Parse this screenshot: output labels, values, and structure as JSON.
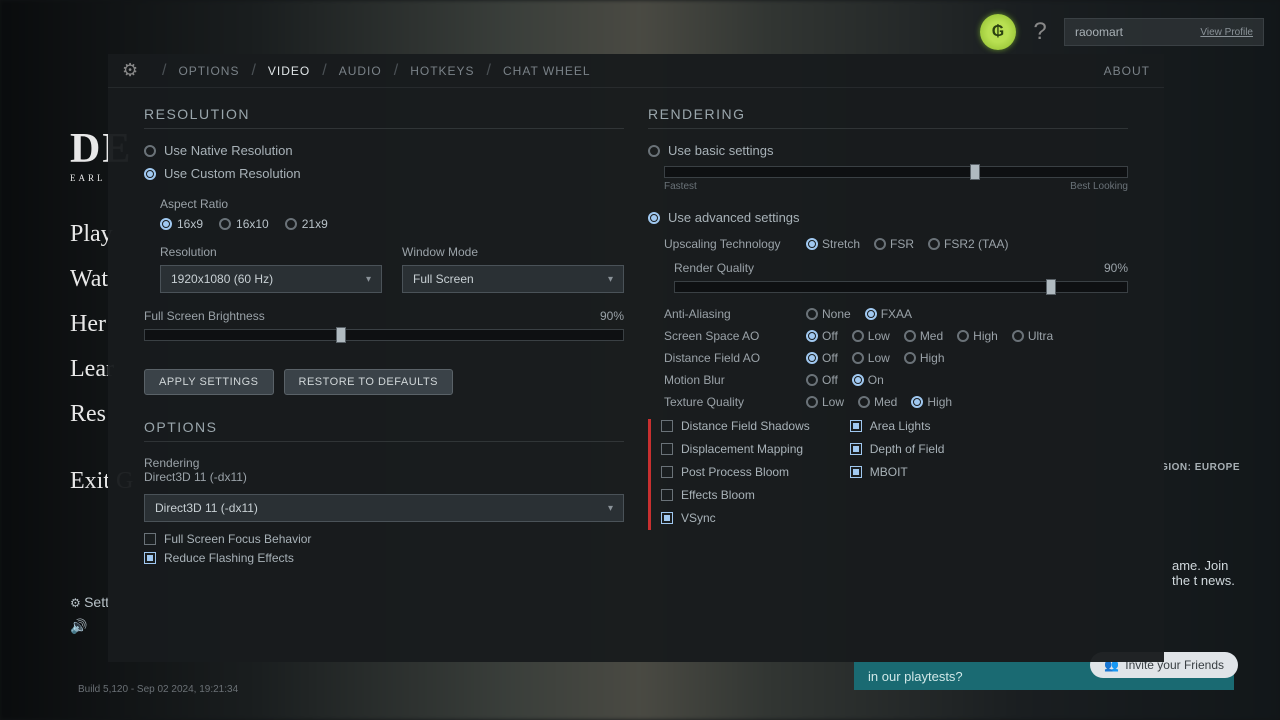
{
  "topbar": {
    "username": "raoomart",
    "view_profile": "View Profile"
  },
  "bg": {
    "logo": "DE",
    "sub": "EARL",
    "items": [
      "Play",
      "Wat",
      "Her",
      "Lear",
      "Res"
    ],
    "exit": "Exit G",
    "settings": "Sett",
    "build": "Build 5,120 - Sep 02 2024, 19:21:34",
    "region": "GION: EUROPE",
    "sidetext": "ame. Join the t news.",
    "playtest": "in our playtests?",
    "invite": "Invite your Friends"
  },
  "tabs": {
    "options": "OPTIONS",
    "video": "VIDEO",
    "audio": "AUDIO",
    "hotkeys": "HOTKEYS",
    "chatwheel": "CHAT WHEEL",
    "about": "ABOUT"
  },
  "left": {
    "resolution_title": "RESOLUTION",
    "native": "Use Native Resolution",
    "custom": "Use Custom Resolution",
    "aspect_label": "Aspect Ratio",
    "aspects": [
      "16x9",
      "16x10",
      "21x9"
    ],
    "resolution_label": "Resolution",
    "resolution_value": "1920x1080 (60 Hz)",
    "window_label": "Window Mode",
    "window_value": "Full Screen",
    "brightness_label": "Full Screen Brightness",
    "brightness_value": "90%",
    "apply": "APPLY SETTINGS",
    "restore": "RESTORE TO DEFAULTS",
    "options_title": "OPTIONS",
    "rendering_label": "Rendering",
    "rendering_value": "Direct3D 11 (-dx11)",
    "rendering_select": "Direct3D 11 (-dx11)",
    "focus": "Full Screen Focus Behavior",
    "flashing": "Reduce Flashing Effects"
  },
  "right": {
    "rendering_title": "RENDERING",
    "basic": "Use basic settings",
    "slider_fastest": "Fastest",
    "slider_best": "Best Looking",
    "advanced": "Use advanced settings",
    "upscale_label": "Upscaling Technology",
    "upscale_opts": [
      "Stretch",
      "FSR",
      "FSR2 (TAA)"
    ],
    "render_quality_label": "Render Quality",
    "render_quality_value": "90%",
    "aa_label": "Anti-Aliasing",
    "aa_opts": [
      "None",
      "FXAA"
    ],
    "ssao_label": "Screen Space AO",
    "ssao_opts": [
      "Off",
      "Low",
      "Med",
      "High",
      "Ultra"
    ],
    "dfao_label": "Distance Field AO",
    "dfao_opts": [
      "Off",
      "Low",
      "High"
    ],
    "blur_label": "Motion Blur",
    "blur_opts": [
      "Off",
      "On"
    ],
    "tex_label": "Texture Quality",
    "tex_opts": [
      "Low",
      "Med",
      "High"
    ],
    "cb_left": [
      "Distance Field Shadows",
      "Displacement Mapping",
      "Post Process Bloom",
      "Effects Bloom",
      "VSync"
    ],
    "cb_right": [
      "Area Lights",
      "Depth of Field",
      "MBOIT"
    ]
  }
}
